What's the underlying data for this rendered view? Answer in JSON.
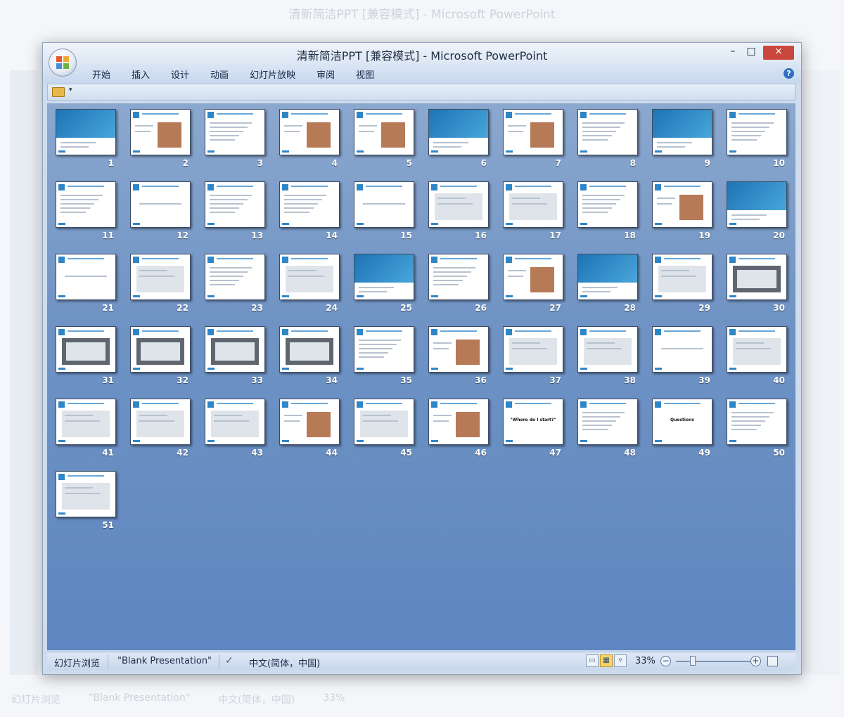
{
  "window": {
    "title": "清新简洁PPT [兼容模式] - Microsoft PowerPoint",
    "minimize": "–",
    "maximize": "□",
    "close": "×"
  },
  "menu": {
    "items": [
      "开始",
      "插入",
      "设计",
      "动画",
      "幻灯片放映",
      "审阅",
      "视图"
    ],
    "help": "?"
  },
  "quick_access": {
    "dropdown": "▾"
  },
  "slides": [
    {
      "num": "1",
      "kind": "map"
    },
    {
      "num": "2",
      "kind": "photo"
    },
    {
      "num": "3",
      "kind": "text"
    },
    {
      "num": "4",
      "kind": "photo"
    },
    {
      "num": "5",
      "kind": "photo"
    },
    {
      "num": "6",
      "kind": "map"
    },
    {
      "num": "7",
      "kind": "photo"
    },
    {
      "num": "8",
      "kind": "text"
    },
    {
      "num": "9",
      "kind": "map"
    },
    {
      "num": "10",
      "kind": "text"
    },
    {
      "num": "11",
      "kind": "text"
    },
    {
      "num": "12",
      "kind": "blank"
    },
    {
      "num": "13",
      "kind": "text"
    },
    {
      "num": "14",
      "kind": "text"
    },
    {
      "num": "15",
      "kind": "blank"
    },
    {
      "num": "16",
      "kind": "shot"
    },
    {
      "num": "17",
      "kind": "shot"
    },
    {
      "num": "18",
      "kind": "text"
    },
    {
      "num": "19",
      "kind": "photo"
    },
    {
      "num": "20",
      "kind": "map"
    },
    {
      "num": "21",
      "kind": "blank"
    },
    {
      "num": "22",
      "kind": "shot"
    },
    {
      "num": "23",
      "kind": "text"
    },
    {
      "num": "24",
      "kind": "shot"
    },
    {
      "num": "25",
      "kind": "map"
    },
    {
      "num": "26",
      "kind": "text"
    },
    {
      "num": "27",
      "kind": "photo"
    },
    {
      "num": "28",
      "kind": "map"
    },
    {
      "num": "29",
      "kind": "shot"
    },
    {
      "num": "30",
      "kind": "dark"
    },
    {
      "num": "31",
      "kind": "dark"
    },
    {
      "num": "32",
      "kind": "dark"
    },
    {
      "num": "33",
      "kind": "dark"
    },
    {
      "num": "34",
      "kind": "dark"
    },
    {
      "num": "35",
      "kind": "text"
    },
    {
      "num": "36",
      "kind": "photo"
    },
    {
      "num": "37",
      "kind": "shot"
    },
    {
      "num": "38",
      "kind": "shot"
    },
    {
      "num": "39",
      "kind": "blank"
    },
    {
      "num": "40",
      "kind": "shot"
    },
    {
      "num": "41",
      "kind": "shot"
    },
    {
      "num": "42",
      "kind": "shot"
    },
    {
      "num": "43",
      "kind": "shot"
    },
    {
      "num": "44",
      "kind": "photo"
    },
    {
      "num": "45",
      "kind": "shot"
    },
    {
      "num": "46",
      "kind": "photo"
    },
    {
      "num": "47",
      "kind": "caption",
      "caption": "\"Where do I start?\""
    },
    {
      "num": "48",
      "kind": "text"
    },
    {
      "num": "49",
      "kind": "caption",
      "caption": "Questions"
    },
    {
      "num": "50",
      "kind": "text"
    },
    {
      "num": "51",
      "kind": "shot"
    }
  ],
  "status": {
    "view_label": "幻灯片浏览",
    "theme": "\"Blank Presentation\"",
    "language": "中文(简体，中国)",
    "zoom": "33%",
    "zoom_level": 0.33,
    "zoom_out": "−",
    "zoom_in": "+"
  },
  "background_window": {
    "status_view": "幻灯片浏览",
    "status_theme": "\"Blank Presentation\"",
    "status_language": "中文(简体，中国)",
    "status_zoom": "33%"
  },
  "colors": {
    "slide_accent": "#2f86c6",
    "sorter_top": "#8ba8cf",
    "sorter_bottom": "#5e86c0",
    "close_button": "#c9473d"
  }
}
